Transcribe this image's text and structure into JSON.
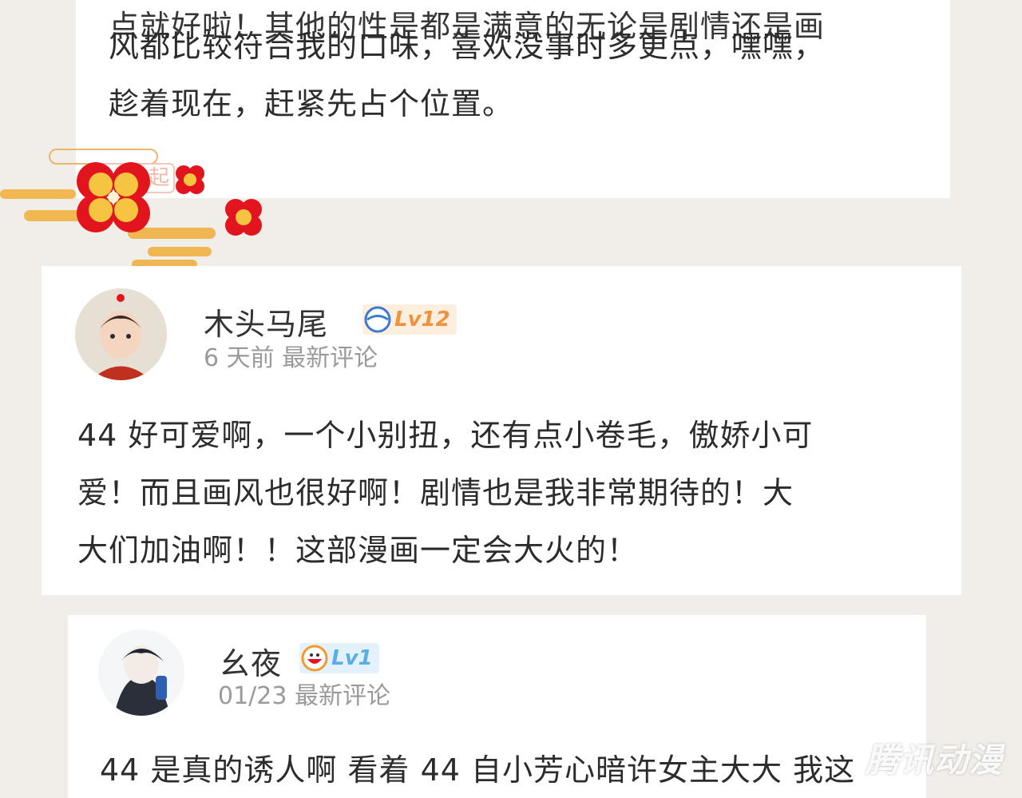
{
  "comments": [
    {
      "cut_line": "点就好啦！其他的性是都是满意的无论是剧情还是画",
      "lines": [
        "风都比较符合我的口味，喜欢没事时多更点，嘿嘿，",
        "趁着现在，赶紧先占个位置。"
      ]
    },
    {
      "username": "木头马尾",
      "level": "Lv12",
      "time": "6 天前",
      "tag": "最新评论",
      "lines": [
        "44 好可爱啊，一个小别扭，还有点小卷毛，傲娇小可",
        "爱！而且画风也很好啊！剧情也是我非常期待的！大",
        "大们加油啊！！这部漫画一定会大火的！"
      ]
    },
    {
      "username": "幺夜",
      "level": "Lv1",
      "time": "01/23",
      "tag": "最新评论",
      "lines": [
        "44 是真的诱人啊 看着 44 自小芳心暗许女主大大 我这"
      ]
    }
  ],
  "decoration": {
    "text": "一起"
  },
  "watermark": "腾讯动漫",
  "colors": {
    "background": "#f1eeea",
    "lv12_badge": "#f0923b",
    "lv1_badge": "#5aaee6",
    "meta_text": "#9a9a9a"
  }
}
